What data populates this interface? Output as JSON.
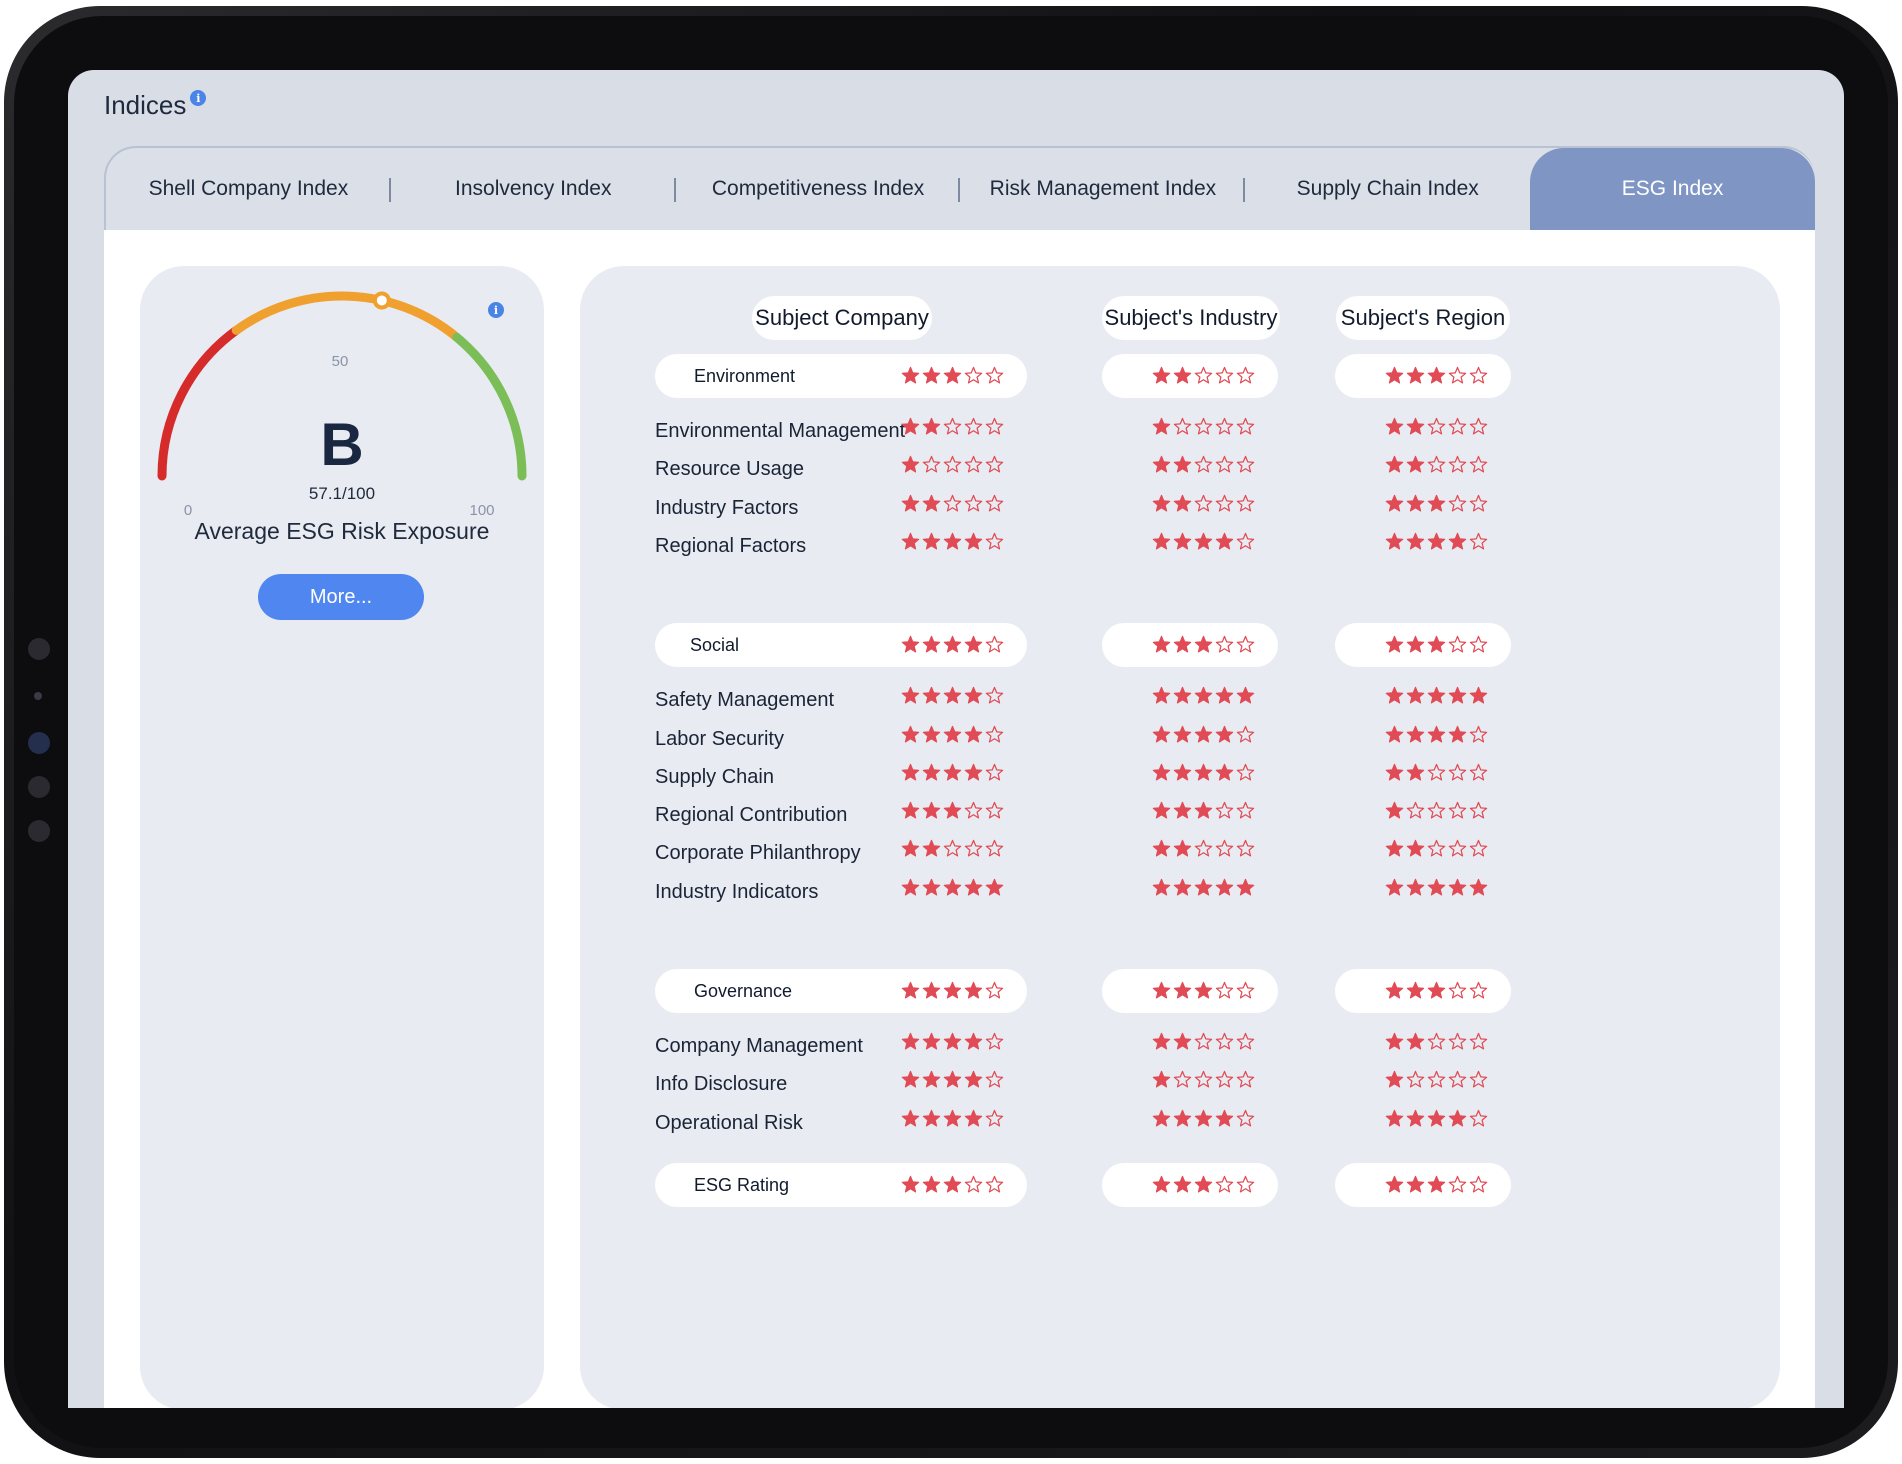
{
  "header": {
    "title": "Indices"
  },
  "tabs": [
    {
      "label": "Shell Company Index",
      "active": false
    },
    {
      "label": "Insolvency Index",
      "active": false
    },
    {
      "label": "Competitiveness Index",
      "active": false
    },
    {
      "label": "Risk Management Index",
      "active": false
    },
    {
      "label": "Supply Chain Index",
      "active": false
    },
    {
      "label": "ESG Index",
      "active": true
    }
  ],
  "gauge": {
    "grade": "B",
    "score": "57.1/100",
    "score_value": 57.1,
    "min_label": "0",
    "mid_label": "50",
    "max_label": "100",
    "label": "Average ESG Risk Exposure",
    "more_label": "More...",
    "colors": {
      "low": "#d62b2b",
      "mid": "#f0a02e",
      "high": "#7bbe57"
    }
  },
  "columns": [
    "Subject Company",
    "Subject's Industry",
    "Subject's Region"
  ],
  "star_color": "#e14b55",
  "categories": [
    {
      "name": "Environment",
      "ratings": [
        3,
        2,
        3
      ],
      "rows": [
        {
          "label": "Environmental Management",
          "ratings": [
            2,
            1,
            2
          ]
        },
        {
          "label": "Resource Usage",
          "ratings": [
            1,
            2,
            2
          ]
        },
        {
          "label": "Industry Factors",
          "ratings": [
            2,
            2,
            3
          ]
        },
        {
          "label": "Regional Factors",
          "ratings": [
            4,
            4,
            4
          ]
        }
      ]
    },
    {
      "name": "Social",
      "ratings": [
        4,
        3,
        3
      ],
      "rows": [
        {
          "label": "Safety Management",
          "ratings": [
            4,
            5,
            5
          ]
        },
        {
          "label": "Labor Security",
          "ratings": [
            4,
            4,
            4
          ]
        },
        {
          "label": "Supply Chain",
          "ratings": [
            4,
            4,
            2
          ]
        },
        {
          "label": "Regional Contribution",
          "ratings": [
            3,
            3,
            1
          ]
        },
        {
          "label": "Corporate Philanthropy",
          "ratings": [
            2,
            2,
            2
          ]
        },
        {
          "label": "Industry Indicators",
          "ratings": [
            5,
            5,
            5
          ]
        }
      ]
    },
    {
      "name": "Governance",
      "ratings": [
        4,
        3,
        3
      ],
      "rows": [
        {
          "label": "Company Management",
          "ratings": [
            4,
            2,
            2
          ]
        },
        {
          "label": "Info Disclosure",
          "ratings": [
            4,
            1,
            1
          ]
        },
        {
          "label": "Operational Risk",
          "ratings": [
            4,
            4,
            4
          ]
        }
      ]
    },
    {
      "name": "ESG Rating",
      "ratings": [
        3,
        3,
        3
      ],
      "rows": []
    }
  ]
}
